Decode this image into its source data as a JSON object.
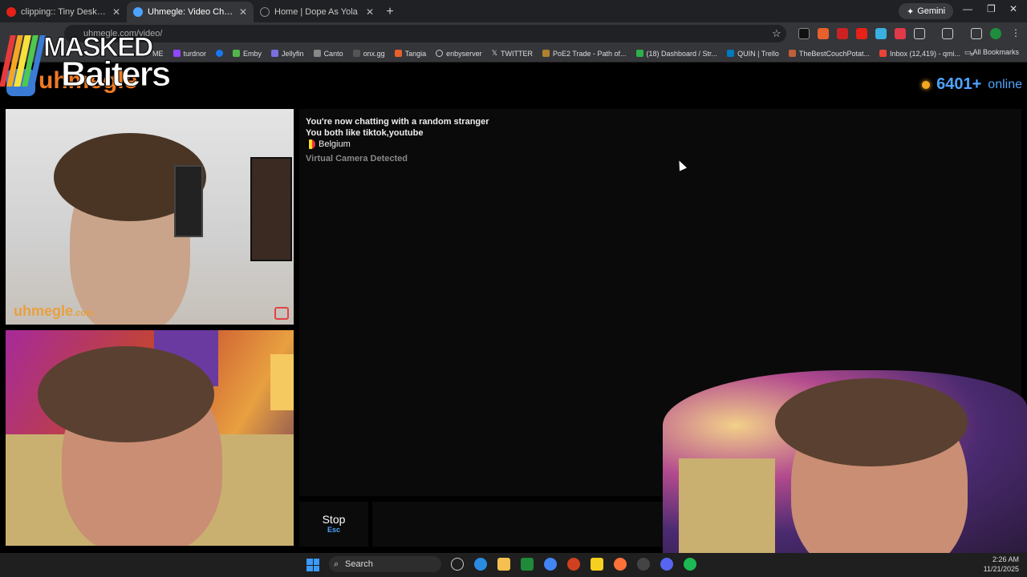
{
  "browser": {
    "tabs": [
      {
        "title": "clipping:: Tiny Desk Concert - Y",
        "favicon_color": "#e62117"
      },
      {
        "title": "Uhmegle: Video Chat | Rand",
        "favicon_color": "#4ea3ff",
        "active": true
      },
      {
        "title": "Home | Dope As Yola",
        "favicon_color": "#888888"
      }
    ],
    "new_tab": "+",
    "gemini_label": "Gemini",
    "url": "uhmegle.com/video/",
    "bookmarks": [
      "ME",
      "turdnor",
      "Emby",
      "Jellyfin",
      "Canto",
      "onx.gg",
      "Tangia",
      "enbyserver",
      "TWITTER",
      "PoE2 Trade - Path of...",
      "(18) Dashboard / Str...",
      "QUIN | Trello",
      "TheBestCouchPotat...",
      "Inbox (12,419) - qmi..."
    ],
    "all_bookmarks": "All Bookmarks"
  },
  "overlay": {
    "line1": "MASKED",
    "line2": "Baiters",
    "stripe_colors": [
      "#e83a3a",
      "#f5a623",
      "#f7e13a",
      "#4ec94e",
      "#3a7bd5"
    ]
  },
  "site": {
    "logo_text": "uhmegle",
    "online_count": "6401+",
    "online_label": "online"
  },
  "remote_video": {
    "watermark": "uhmegle",
    "watermark_suffix": ".com"
  },
  "chat": {
    "status": "You're now chatting with a random stranger",
    "interests": "You both like tiktok,youtube",
    "country": "Belgium",
    "warning": "Virtual Camera Detected"
  },
  "controls": {
    "stop_label": "Stop",
    "stop_hint": "Esc"
  },
  "taskbar": {
    "search_label": "Search",
    "time": "2:26 AM",
    "date": "11/21/2025"
  }
}
